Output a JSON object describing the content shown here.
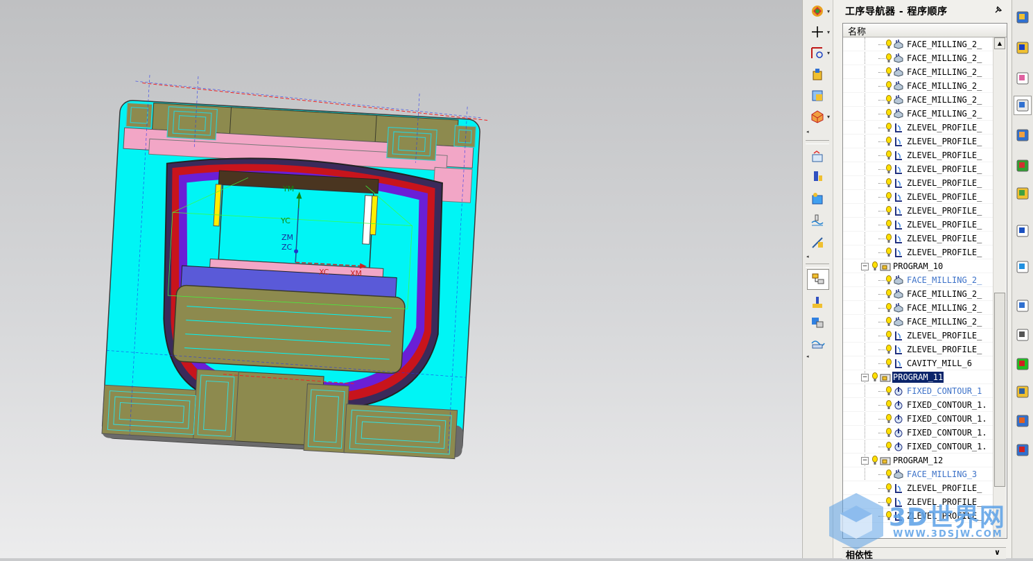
{
  "navigator": {
    "title": "工序导航器 - 程序顺序",
    "column_header": "名称",
    "dependencies_label": "相依性",
    "rows": [
      {
        "label": "FACE_MILLING_2_",
        "kind": "op",
        "icon": "face-mill-icon",
        "level": 2,
        "style": "normal"
      },
      {
        "label": "FACE_MILLING_2_",
        "kind": "op",
        "icon": "face-mill-icon",
        "level": 2,
        "style": "normal"
      },
      {
        "label": "FACE_MILLING_2_",
        "kind": "op",
        "icon": "face-mill-icon",
        "level": 2,
        "style": "normal"
      },
      {
        "label": "FACE_MILLING_2_",
        "kind": "op",
        "icon": "face-mill-icon",
        "level": 2,
        "style": "normal"
      },
      {
        "label": "FACE_MILLING_2_",
        "kind": "op",
        "icon": "face-mill-icon",
        "level": 2,
        "style": "normal"
      },
      {
        "label": "FACE_MILLING_2_",
        "kind": "op",
        "icon": "face-mill-icon",
        "level": 2,
        "style": "normal"
      },
      {
        "label": "ZLEVEL_PROFILE_",
        "kind": "op",
        "icon": "zlevel-icon",
        "level": 2,
        "style": "normal"
      },
      {
        "label": "ZLEVEL_PROFILE_",
        "kind": "op",
        "icon": "zlevel-icon",
        "level": 2,
        "style": "normal"
      },
      {
        "label": "ZLEVEL_PROFILE_",
        "kind": "op",
        "icon": "zlevel-icon",
        "level": 2,
        "style": "normal"
      },
      {
        "label": "ZLEVEL_PROFILE_",
        "kind": "op",
        "icon": "zlevel-icon",
        "level": 2,
        "style": "normal"
      },
      {
        "label": "ZLEVEL_PROFILE_",
        "kind": "op",
        "icon": "zlevel-icon",
        "level": 2,
        "style": "normal"
      },
      {
        "label": "ZLEVEL_PROFILE_",
        "kind": "op",
        "icon": "zlevel-icon",
        "level": 2,
        "style": "normal"
      },
      {
        "label": "ZLEVEL_PROFILE_",
        "kind": "op",
        "icon": "zlevel-icon",
        "level": 2,
        "style": "normal"
      },
      {
        "label": "ZLEVEL_PROFILE_",
        "kind": "op",
        "icon": "zlevel-icon",
        "level": 2,
        "style": "normal"
      },
      {
        "label": "ZLEVEL_PROFILE_",
        "kind": "op",
        "icon": "zlevel-icon",
        "level": 2,
        "style": "normal"
      },
      {
        "label": "ZLEVEL_PROFILE_",
        "kind": "op",
        "icon": "zlevel-icon",
        "level": 2,
        "style": "normal"
      },
      {
        "label": "PROGRAM_10",
        "kind": "program",
        "icon": "program-folder-icon",
        "level": 1,
        "style": "normal"
      },
      {
        "label": "FACE_MILLING_2_",
        "kind": "op",
        "icon": "face-mill-icon",
        "level": 2,
        "style": "blue"
      },
      {
        "label": "FACE_MILLING_2_",
        "kind": "op",
        "icon": "face-mill-icon",
        "level": 2,
        "style": "normal"
      },
      {
        "label": "FACE_MILLING_2_",
        "kind": "op",
        "icon": "face-mill-icon",
        "level": 2,
        "style": "normal"
      },
      {
        "label": "FACE_MILLING_2_",
        "kind": "op",
        "icon": "face-mill-icon",
        "level": 2,
        "style": "normal"
      },
      {
        "label": "ZLEVEL_PROFILE_",
        "kind": "op",
        "icon": "zlevel-icon",
        "level": 2,
        "style": "normal"
      },
      {
        "label": "ZLEVEL_PROFILE_",
        "kind": "op",
        "icon": "zlevel-icon",
        "level": 2,
        "style": "normal"
      },
      {
        "label": "CAVITY_MILL_6",
        "kind": "op",
        "icon": "zlevel-icon",
        "level": 2,
        "style": "normal"
      },
      {
        "label": "PROGRAM_11",
        "kind": "program",
        "icon": "program-folder-icon",
        "level": 1,
        "style": "selected"
      },
      {
        "label": "FIXED_CONTOUR_1",
        "kind": "op",
        "icon": "contour-icon",
        "level": 2,
        "style": "blue"
      },
      {
        "label": "FIXED_CONTOUR_1.",
        "kind": "op",
        "icon": "contour-icon",
        "level": 2,
        "style": "normal"
      },
      {
        "label": "FIXED_CONTOUR_1.",
        "kind": "op",
        "icon": "contour-icon",
        "level": 2,
        "style": "normal"
      },
      {
        "label": "FIXED_CONTOUR_1.",
        "kind": "op",
        "icon": "contour-icon",
        "level": 2,
        "style": "normal"
      },
      {
        "label": "FIXED_CONTOUR_1.",
        "kind": "op",
        "icon": "contour-icon",
        "level": 2,
        "style": "normal"
      },
      {
        "label": "PROGRAM_12",
        "kind": "program",
        "icon": "program-folder-icon",
        "level": 1,
        "style": "normal"
      },
      {
        "label": "FACE_MILLING_3",
        "kind": "op",
        "icon": "face-mill-icon",
        "level": 2,
        "style": "blue"
      },
      {
        "label": "ZLEVEL_PROFILE_",
        "kind": "op",
        "icon": "zlevel-icon",
        "level": 2,
        "style": "normal"
      },
      {
        "label": "ZLEVEL_PROFILE_",
        "kind": "op",
        "icon": "zlevel-icon",
        "level": 2,
        "style": "normal"
      },
      {
        "label": "ZLEVEL_PROFILE_",
        "kind": "op",
        "icon": "zlevel-icon",
        "level": 2,
        "style": "normal"
      }
    ]
  },
  "viewport": {
    "axis_labels": {
      "ym": "YM",
      "yc": "YC",
      "zm": "ZM",
      "zc": "ZC",
      "xc": "XC",
      "xm": "XM"
    }
  },
  "watermark": {
    "text": "3D世界网",
    "url": "WWW.3DSJW.COM"
  },
  "colors": {
    "selection": "#0a246a",
    "inactive_op": "#3d72c8",
    "model_cyan": "#00ffff",
    "model_olive": "#8d8a4e",
    "model_purple": "#6a1fd6",
    "model_pink": "#f2a6c6"
  },
  "toolbar_icons": [
    "display-tool-icon",
    "wcs-origin-icon",
    "orient-wcs-icon",
    "create-program-icon",
    "create-tool-icon",
    "create-geometry-icon",
    "generate-path-icon",
    "replay-path-icon",
    "verify-path-icon",
    "list-path-icon",
    "post-process-icon",
    "program-order-view-icon",
    "machine-tool-view-icon",
    "geometry-view-icon",
    "method-view-icon"
  ],
  "resource_icons": [
    "assembly-nav-icon",
    "constraint-nav-icon",
    "part-nav-icon",
    "operation-nav-icon",
    "reuse-library-icon",
    "hd3d-icon",
    "roles-icon",
    "info-icon",
    "web-browser-icon",
    "history-icon",
    "process-studio-icon",
    "palette-icon",
    "system-materials-icon",
    "users-icon",
    "visual-report-icon"
  ]
}
